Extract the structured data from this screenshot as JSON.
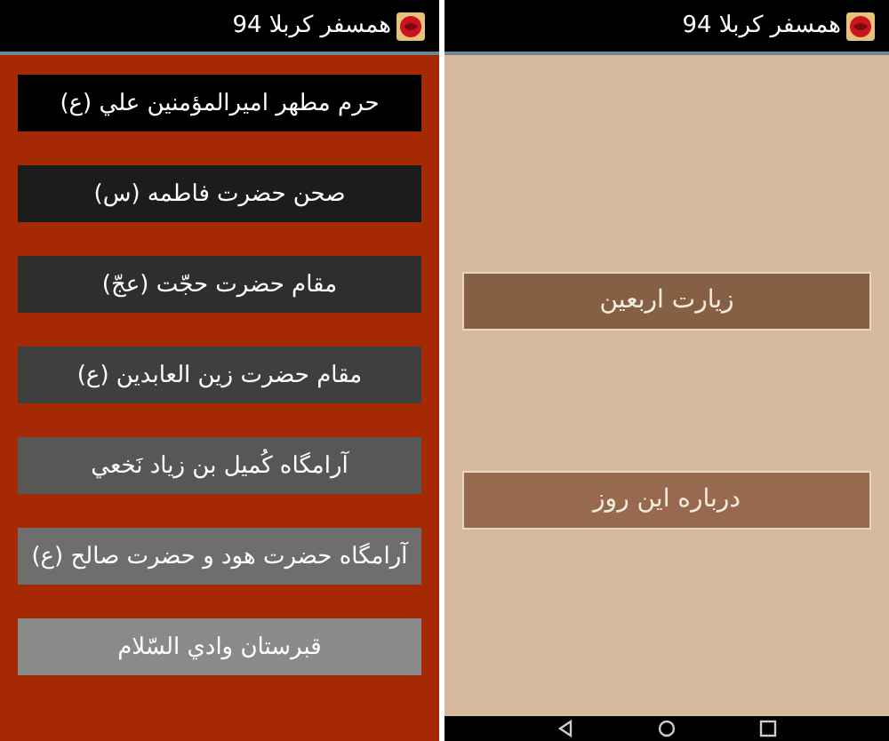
{
  "screens": [
    {
      "title": "همسفر کربلا 94",
      "kind": "menu",
      "buttons": [
        {
          "label": "زيارت اربعين",
          "color": "#866045"
        },
        {
          "label": "درباره اين روز",
          "color": "#976a4f"
        }
      ]
    },
    {
      "title": "همسفر کربلا 94",
      "kind": "list",
      "buttons": [
        {
          "label": "حرم مطهر اميرالمؤمنين علي (ع)",
          "color": "#000000"
        },
        {
          "label": "صحن حضرت فاطمه (س)",
          "color": "#1c1c1c"
        },
        {
          "label": "مقام حضرت حجّت (عجّ)",
          "color": "#2e2e2e"
        },
        {
          "label": "مقام حضرت زين العابدين (ع)",
          "color": "#3f3f3f"
        },
        {
          "label": "آرامگاه کُميل بن زياد نَخعي",
          "color": "#575757"
        },
        {
          "label": "آرامگاه حضرت هود و حضرت صالح (ع)",
          "color": "#6e6e6e"
        },
        {
          "label": "قبرستان وادي السّلام",
          "color": "#8a8a8a"
        }
      ]
    }
  ]
}
